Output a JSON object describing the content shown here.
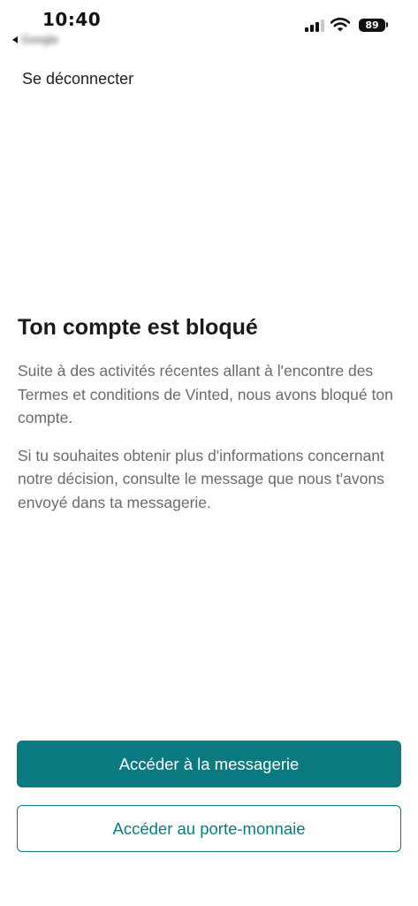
{
  "status_bar": {
    "time": "10:40",
    "back_app_label": "Google",
    "battery_level": "89",
    "icons": [
      "signal-icon",
      "wifi-icon",
      "battery-icon"
    ]
  },
  "header": {
    "logout_label": "Se déconnecter"
  },
  "main": {
    "title": "Ton compte est bloqué",
    "paragraph_1": "Suite à des activités récentes allant à l'encontre des Termes et conditions de Vinted, nous avons bloqué ton compte.",
    "paragraph_2": "Si tu souhaites obtenir plus d'informations concernant notre décision, consulte le message que nous t'avons envoyé dans ta messagerie."
  },
  "actions": {
    "primary_label": "Accéder à la messagerie",
    "secondary_label": "Accéder au porte-monnaie"
  },
  "colors": {
    "accent": "#0b7a80",
    "body_text": "#6a6a6a",
    "title_text": "#1a1a1a"
  }
}
